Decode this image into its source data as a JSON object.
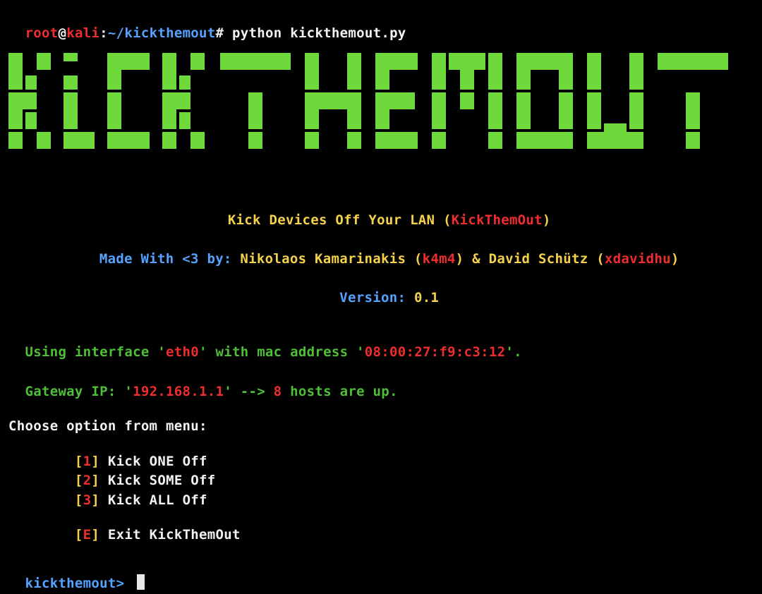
{
  "prompt": {
    "user": "root",
    "at": "@",
    "host": "kali",
    "colon": ":",
    "path": "~/kickthemout",
    "hash": "#",
    "command": "python kickthemout.py"
  },
  "banner_ascii": "█ █▀▀ ▀ █▀▀ █ █▀ ▀▀█▀▀ █ █ █▀▀ █▀▄▀█ █▀▀█ █ █ ▀▀█▀▀\n█▀▄  █ █   █▀▄    █   █▀▀█ █▀▀ █ ▀ █ █  █ █ █   █\n▀ ▀ ▀▀▀ ▀▀▀ ▀ ▀   ▀   ▀  ▀ ▀▀▀ ▀   ▀ ▀▀▀▀ ▀▀▀   ▀",
  "header": {
    "tagline": "Kick Devices Off Your LAN (",
    "appname": "KickThemOut",
    "tag_close": ")",
    "made_with": "Made With <3 by: ",
    "author1": "Nikolaos Kamarinakis (",
    "author1_handle": "k4m4",
    "between": ") & David Schütz (",
    "author2_handle": "xdavidhu",
    "close2": ")",
    "version_label": "Version: ",
    "version_value": "0.1"
  },
  "net": {
    "iface_pre": "Using interface '",
    "iface": "eth0",
    "iface_mid": "' with mac address '",
    "mac": "08:00:27:f9:c3:12",
    "iface_post": "'.",
    "gw_pre": "Gateway IP: '",
    "gw_ip": "192.168.1.1",
    "gw_mid": "' --> ",
    "hosts": "8",
    "gw_post": " hosts are up."
  },
  "menu": {
    "heading": "Choose option from menu:",
    "items": [
      {
        "key": "1",
        "label": "Kick ONE Off"
      },
      {
        "key": "2",
        "label": "Kick SOME Off"
      },
      {
        "key": "3",
        "label": "Kick ALL Off"
      },
      {
        "key": "E",
        "label": "Exit KickThemOut"
      }
    ]
  },
  "input_prompt": "kickthemout> "
}
